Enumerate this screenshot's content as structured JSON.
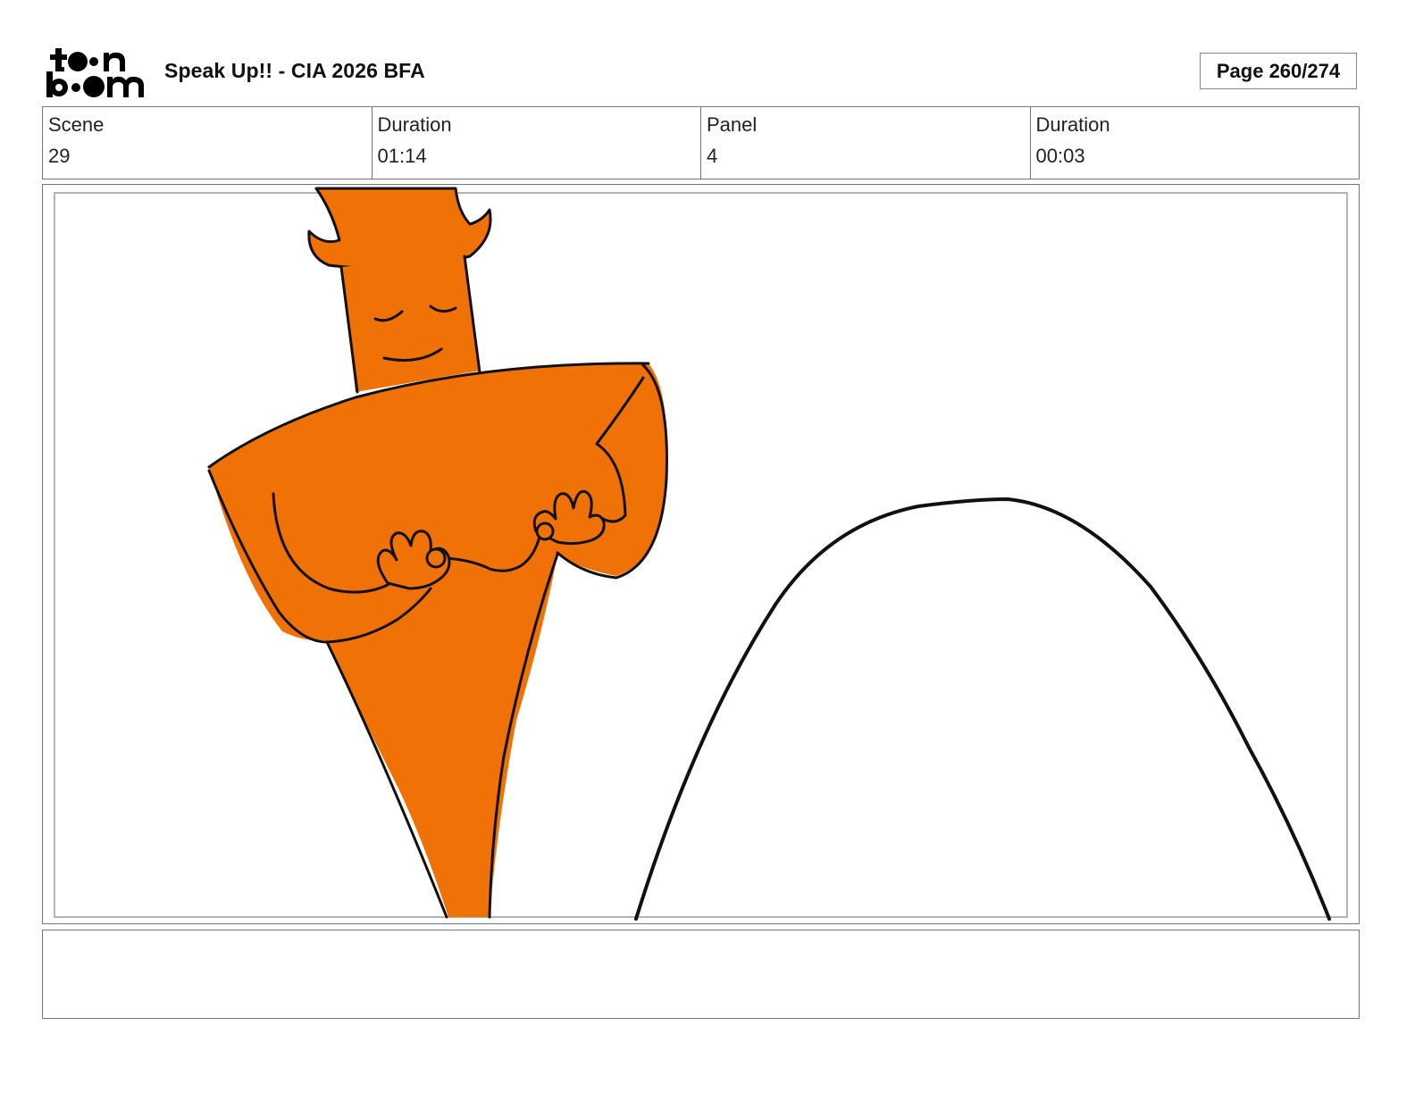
{
  "header": {
    "logo_text": "toon boom",
    "project_title": "Speak Up!! - CIA 2026 BFA",
    "page_indicator": "Page 260/274"
  },
  "info": {
    "scene_label": "Scene",
    "scene_value": "29",
    "scene_duration_label": "Duration",
    "scene_duration_value": "01:14",
    "panel_label": "Panel",
    "panel_value": "4",
    "panel_duration_label": "Duration",
    "panel_duration_value": "00:03"
  },
  "drawing": {
    "character_color": "#F07206",
    "line_color": "#111111"
  },
  "notes": {
    "text": ""
  }
}
